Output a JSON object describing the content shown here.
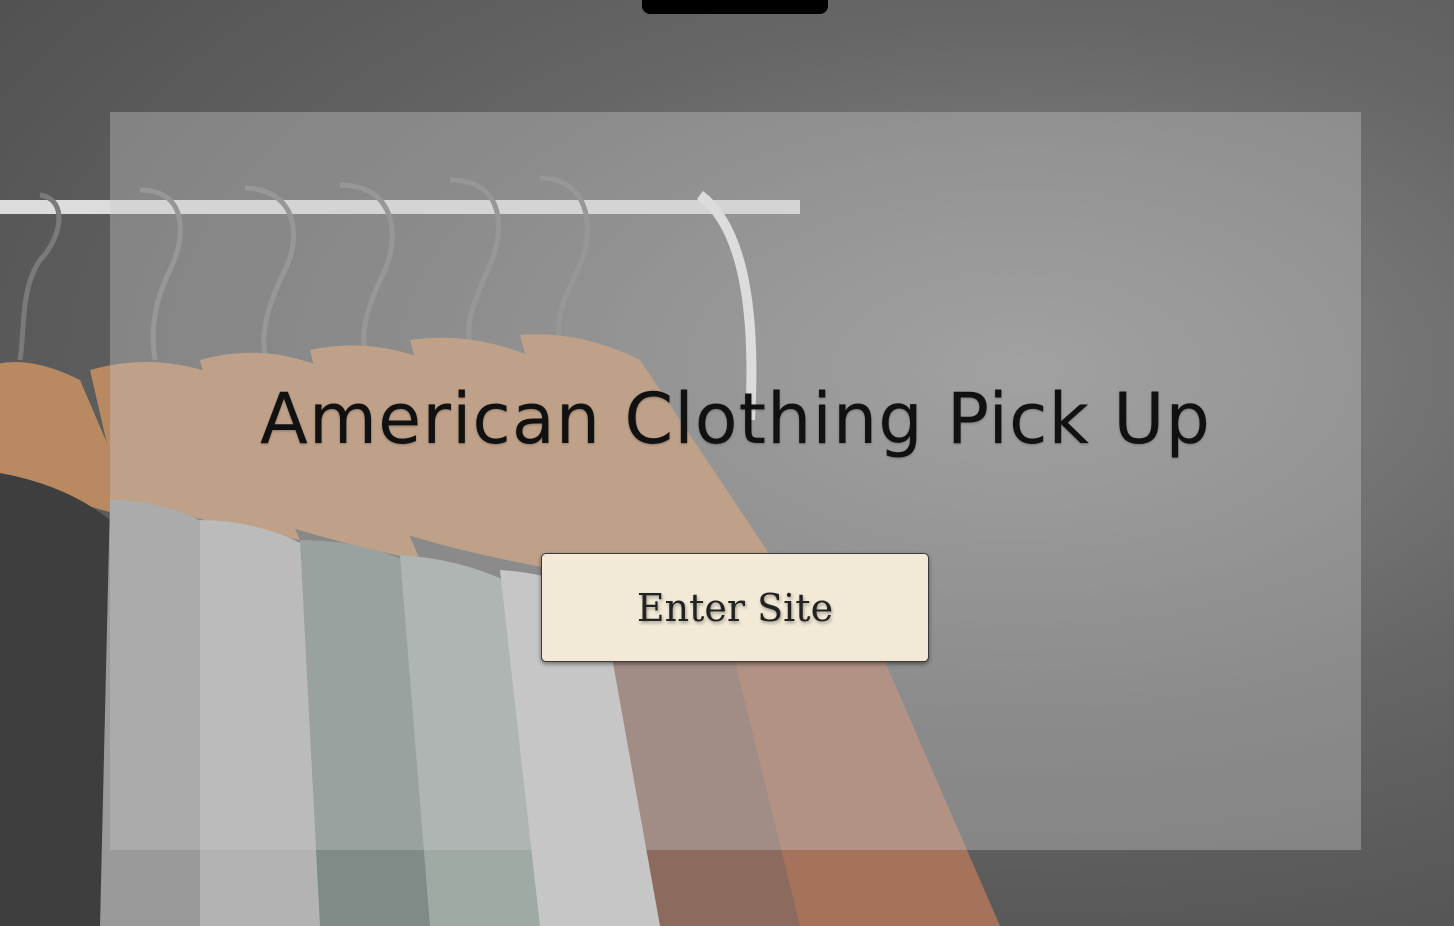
{
  "hero": {
    "title": "American Clothing Pick Up",
    "enter_button_label": "Enter Site"
  },
  "colors": {
    "page_background": "#4d4d4d",
    "overlay": "#c8c8c8",
    "button_background": "#f2ead6",
    "title_text": "#111111",
    "top_tab": "#000000"
  },
  "background_image": {
    "subject": "clothing-rack-hangers-icon"
  }
}
